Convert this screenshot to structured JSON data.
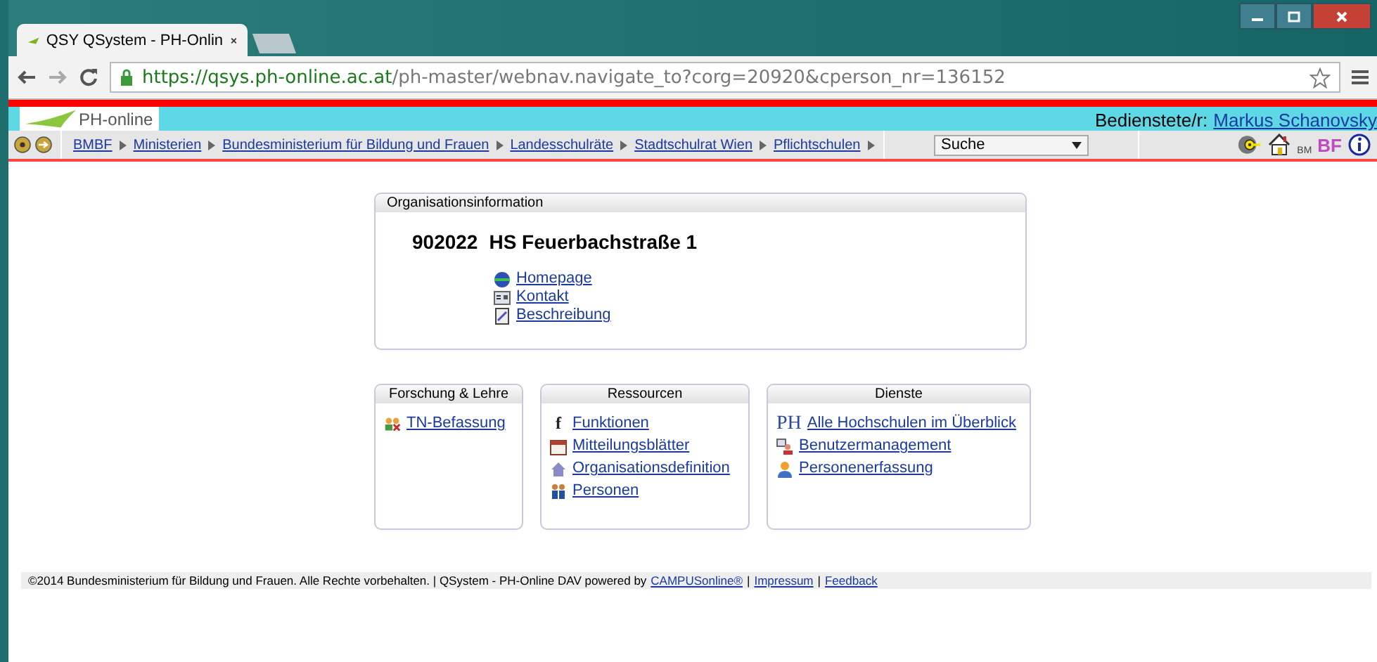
{
  "browser": {
    "tab_title": "QSY QSystem - PH-Onlin",
    "url_host": "https://qsys.ph-online.ac.at",
    "url_path": "/ph-master/webnav.navigate_to?corg=20920&cperson_nr=136152"
  },
  "header": {
    "logo_text": "PH-online",
    "user_label": "Bedienstete/r:",
    "user_name": "Markus Schanovsky"
  },
  "breadcrumbs": [
    "BMBF",
    "Ministerien",
    "Bundesministerium für Bildung und Frauen",
    "Landesschulräte",
    "Stadtschulrat Wien",
    "Pflichtschulen"
  ],
  "search": {
    "value": "Suche"
  },
  "toolbar": {
    "bm_text": "BM",
    "bf_text": "BF"
  },
  "org_info": {
    "title": "Organisationsinformation",
    "number": "902022",
    "name": "HS Feuerbachstraße 1",
    "links": [
      {
        "kind": "globe",
        "label": "Homepage"
      },
      {
        "kind": "card",
        "label": "Kontakt"
      },
      {
        "kind": "note",
        "label": "Beschreibung"
      }
    ]
  },
  "panels": [
    {
      "title": "Forschung & Lehre",
      "links": [
        {
          "kind": "people",
          "label": "TN-Befassung"
        }
      ]
    },
    {
      "title": "Ressourcen",
      "links": [
        {
          "kind": "letter",
          "label": "Funktionen",
          "icon_text": "f"
        },
        {
          "kind": "calendar",
          "label": "Mitteilungsblätter"
        },
        {
          "kind": "house",
          "label": "Organisationsdefinition"
        },
        {
          "kind": "pair",
          "label": "Personen"
        }
      ]
    },
    {
      "title": "Dienste",
      "links": [
        {
          "kind": "letter",
          "label": "Alle Hochschulen im Überblick",
          "icon_text": "PH"
        },
        {
          "kind": "user",
          "label": "Benutzermanagement"
        },
        {
          "kind": "person",
          "label": "Personenerfassung"
        }
      ]
    }
  ],
  "footer": {
    "separator": "|",
    "copyright": "©2014 Bundesministerium für Bildung und Frauen. Alle Rechte vorbehalten. | QSystem - PH-Online DAV powered by",
    "links": [
      {
        "label": "CAMPUSonline®"
      },
      {
        "label": "Impressum"
      },
      {
        "label": "Feedback"
      }
    ]
  }
}
